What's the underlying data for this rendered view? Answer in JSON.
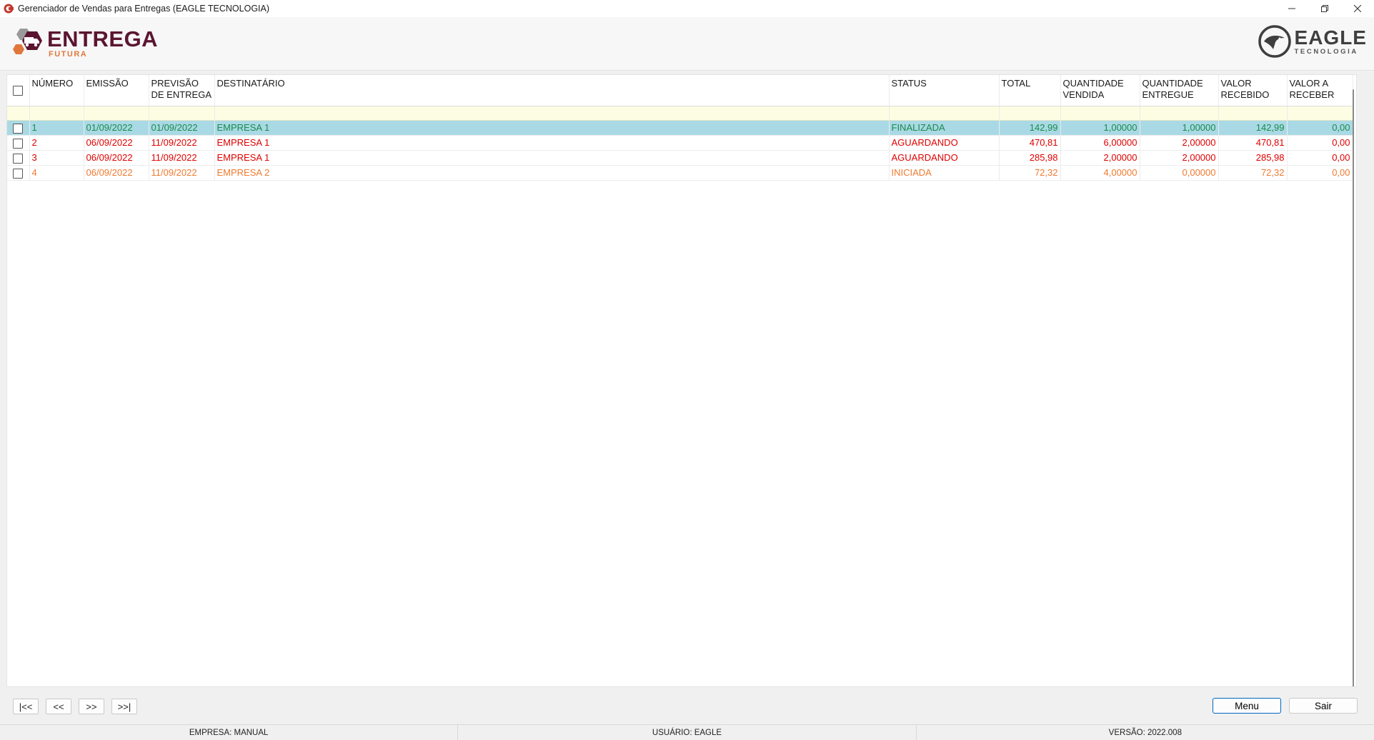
{
  "window": {
    "title": "Gerenciador de Vendas para Entregas (EAGLE TECNOLOGIA)"
  },
  "logos": {
    "entrega_main": "ENTREGA",
    "entrega_sub": "FUTURA",
    "eagle_main": "EAGLE",
    "eagle_sub": "TECNOLOGIA"
  },
  "colors": {
    "finalizada": "#1a8a4a",
    "aguardando": "#e00000",
    "iniciada": "#f07a30",
    "selected_row": "#a9d9e5",
    "filter_row": "#fdfde4",
    "brand_wine": "#5b1530",
    "brand_orange": "#e0783d"
  },
  "grid": {
    "columns": [
      "NÚMERO",
      "EMISSÃO",
      "PREVISÃO DE ENTREGA",
      "DESTINATÁRIO",
      "STATUS",
      "TOTAL",
      "QUANTIDADE VENDIDA",
      "QUANTIDADE ENTREGUE",
      "VALOR RECEBIDO",
      "VALOR A RECEBER"
    ],
    "rows": [
      {
        "numero": "1",
        "emissao": "01/09/2022",
        "previsao": "01/09/2022",
        "destinatario": "EMPRESA 1",
        "status": "FINALIZADA",
        "total": "142,99",
        "qtd_vendida": "1,00000",
        "qtd_entregue": "1,00000",
        "valor_recebido": "142,99",
        "valor_a_receber": "0,00"
      },
      {
        "numero": "2",
        "emissao": "06/09/2022",
        "previsao": "11/09/2022",
        "destinatario": "EMPRESA 1",
        "status": "AGUARDANDO",
        "total": "470,81",
        "qtd_vendida": "6,00000",
        "qtd_entregue": "2,00000",
        "valor_recebido": "470,81",
        "valor_a_receber": "0,00"
      },
      {
        "numero": "3",
        "emissao": "06/09/2022",
        "previsao": "11/09/2022",
        "destinatario": "EMPRESA 1",
        "status": "AGUARDANDO",
        "total": "285,98",
        "qtd_vendida": "2,00000",
        "qtd_entregue": "2,00000",
        "valor_recebido": "285,98",
        "valor_a_receber": "0,00"
      },
      {
        "numero": "4",
        "emissao": "06/09/2022",
        "previsao": "11/09/2022",
        "destinatario": "EMPRESA 2",
        "status": "INICIADA",
        "total": "72,32",
        "qtd_vendida": "4,00000",
        "qtd_entregue": "0,00000",
        "valor_recebido": "72,32",
        "valor_a_receber": "0,00"
      }
    ]
  },
  "nav": {
    "first": "|<<",
    "prev": "<<",
    "next": ">>",
    "last": ">>|"
  },
  "actions": {
    "menu": "Menu",
    "sair": "Sair"
  },
  "status": {
    "empresa": "EMPRESA: MANUAL",
    "usuario": "USUÁRIO: EAGLE",
    "versao": "VERSÃO: 2022.008"
  }
}
